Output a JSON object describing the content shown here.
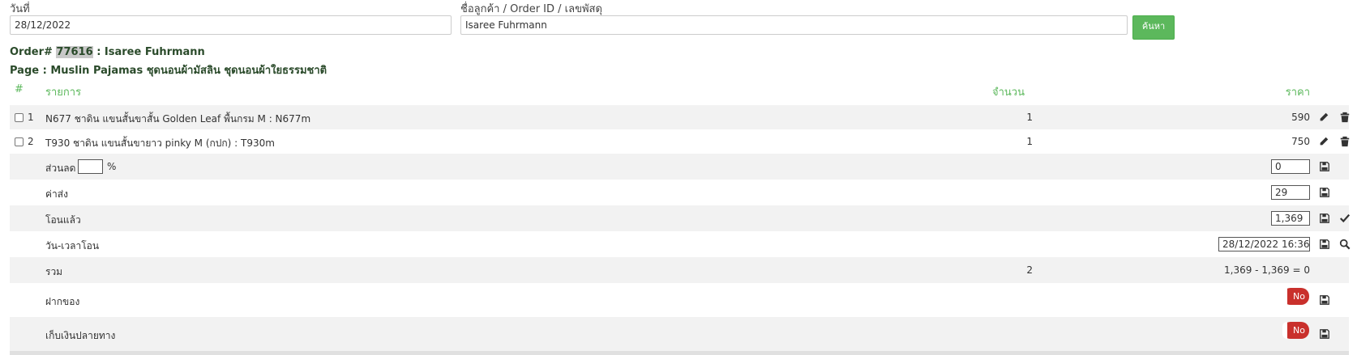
{
  "search": {
    "date_label": "วันที่",
    "date_value": "28/12/2022",
    "customer_label": "ชื่อลูกค้า / Order ID / เลขพัสดุ",
    "customer_value": "Isaree Fuhrmann",
    "search_button": "ค้นหา"
  },
  "order": {
    "prefix": "Order#",
    "id": "77616",
    "customer": ": Isaree Fuhrmann",
    "page": "Page : Muslin Pajamas ชุดนอนผ้ามัสลิน ชุดนอนผ้าใยธรรมชาติ"
  },
  "table": {
    "headers": {
      "num": "#",
      "item": "รายการ",
      "qty": "จำนวน",
      "price": "ราคา"
    },
    "items": [
      {
        "num": "1",
        "name": "N677 ชาดิน แขนสั้นขาสั้น Golden Leaf พื้นกรม M : N677m",
        "qty": "1",
        "price": "590"
      },
      {
        "num": "2",
        "name": "T930 ชาดิน แขนสั้นขายาว pinky M (กปก) : T930m",
        "qty": "1",
        "price": "750"
      }
    ],
    "discount": {
      "label": "ส่วนลด",
      "percent_value": "",
      "percent_sign": "%",
      "value": "0"
    },
    "shipping": {
      "label": "ค่าส่ง",
      "value": "29"
    },
    "paid": {
      "label": "โอนแล้ว",
      "value": "1,369"
    },
    "transfer_time": {
      "label": "วัน-เวลาโอน",
      "value": "28/12/2022 16:36"
    },
    "total": {
      "label": "รวม",
      "qty": "2",
      "summary": "1,369 - 1,369 = 0"
    },
    "deposit": {
      "label": "ฝากของ",
      "toggle": "No"
    },
    "cod": {
      "label": "เก็บเงินปลายทาง",
      "toggle": "No"
    }
  },
  "colors": {
    "accent_green": "#5cb85c",
    "toggle_red": "#c9302c"
  },
  "icons": {
    "edit": "pencil-icon",
    "delete": "trash-icon",
    "save": "floppy-disk-icon",
    "confirm": "checkmark-icon",
    "search": "magnifier-icon"
  }
}
